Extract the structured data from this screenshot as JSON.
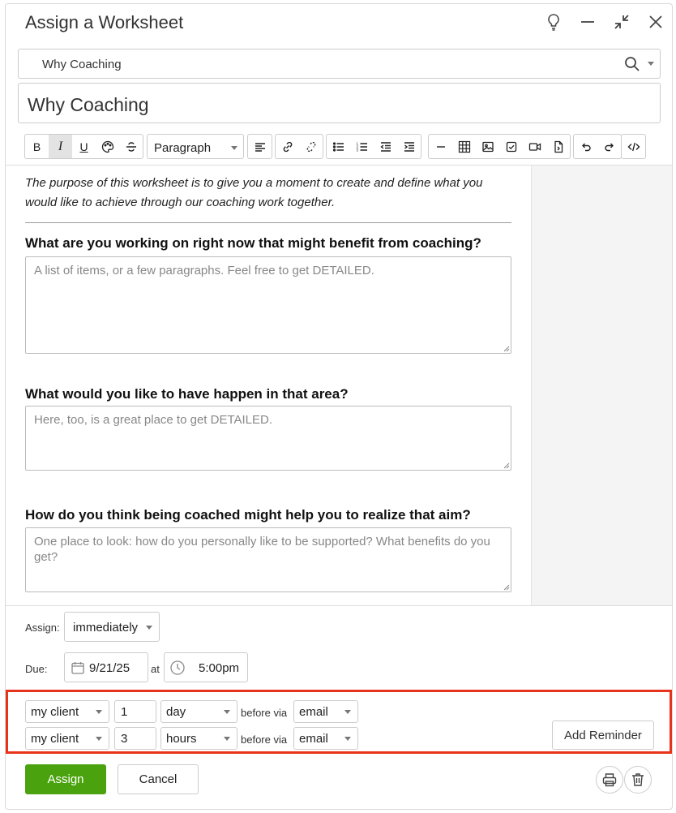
{
  "dialog": {
    "title": "Assign a Worksheet",
    "icons": [
      "lightbulb-icon",
      "minimize-icon",
      "collapse-icon",
      "close-icon"
    ]
  },
  "worksheet_select": {
    "value": "Why Coaching",
    "icon": "search-icon"
  },
  "title_field": {
    "value": "Why Coaching"
  },
  "toolbar": {
    "bold": "B",
    "italic": "I",
    "underline": "U",
    "paragraph_select": "Paragraph"
  },
  "editor": {
    "intro": "The purpose of this worksheet is to give you a moment to create and define what you would like to achieve through our coaching work together.",
    "questions": [
      {
        "label": "What are you working on right now that might benefit from coaching?",
        "placeholder": "A list of items, or a few paragraphs.  Feel free to get DETAILED."
      },
      {
        "label": "What would you like to have happen in that area?",
        "placeholder": "Here, too, is a great place to get DETAILED."
      },
      {
        "label": "How do you think being coached might help you to realize that aim?",
        "placeholder": "One place to look: how do you personally like to be supported? What benefits do you get?"
      }
    ]
  },
  "schedule": {
    "assign_label": "Assign:",
    "assign_value": "immediately",
    "due_label": "Due:",
    "due_date": "9/21/25",
    "at_label": "at",
    "due_time": "5:00pm"
  },
  "reminders": {
    "rows": [
      {
        "recipient": "my client",
        "amount": "1",
        "unit": "day",
        "before_via": "before via",
        "channel": "email"
      },
      {
        "recipient": "my client",
        "amount": "3",
        "unit": "hours",
        "before_via": "before via",
        "channel": "email"
      }
    ],
    "add_label": "Add Reminder",
    "highlight_color": "#e8331c"
  },
  "footer": {
    "assign_label": "Assign",
    "cancel_label": "Cancel",
    "assign_color": "#4aa30e"
  }
}
